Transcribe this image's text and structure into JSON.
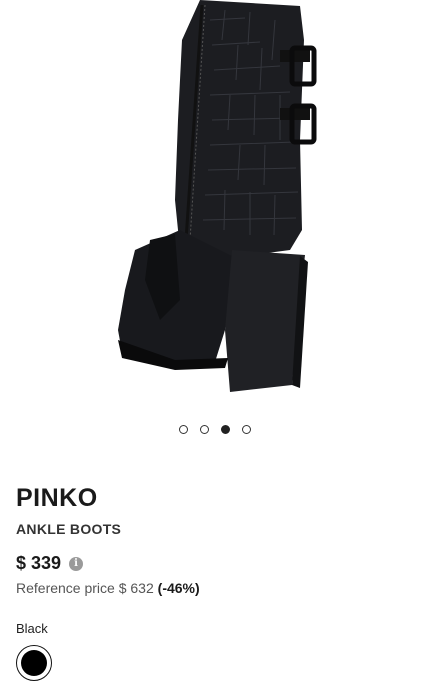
{
  "gallery": {
    "image_alt": "Black croc-embossed ankle boot with buckles and block heel",
    "slide_count": 4,
    "active_slide": 3
  },
  "product": {
    "brand": "PINKO",
    "type": "ANKLE BOOTS",
    "price": "$ 339",
    "info_icon_glyph": "i",
    "reference_label": "Reference price $ 632",
    "discount": "(-46%)",
    "color_label": "Black",
    "swatch_color": "#000000"
  },
  "icons": {
    "info": "info-icon"
  }
}
